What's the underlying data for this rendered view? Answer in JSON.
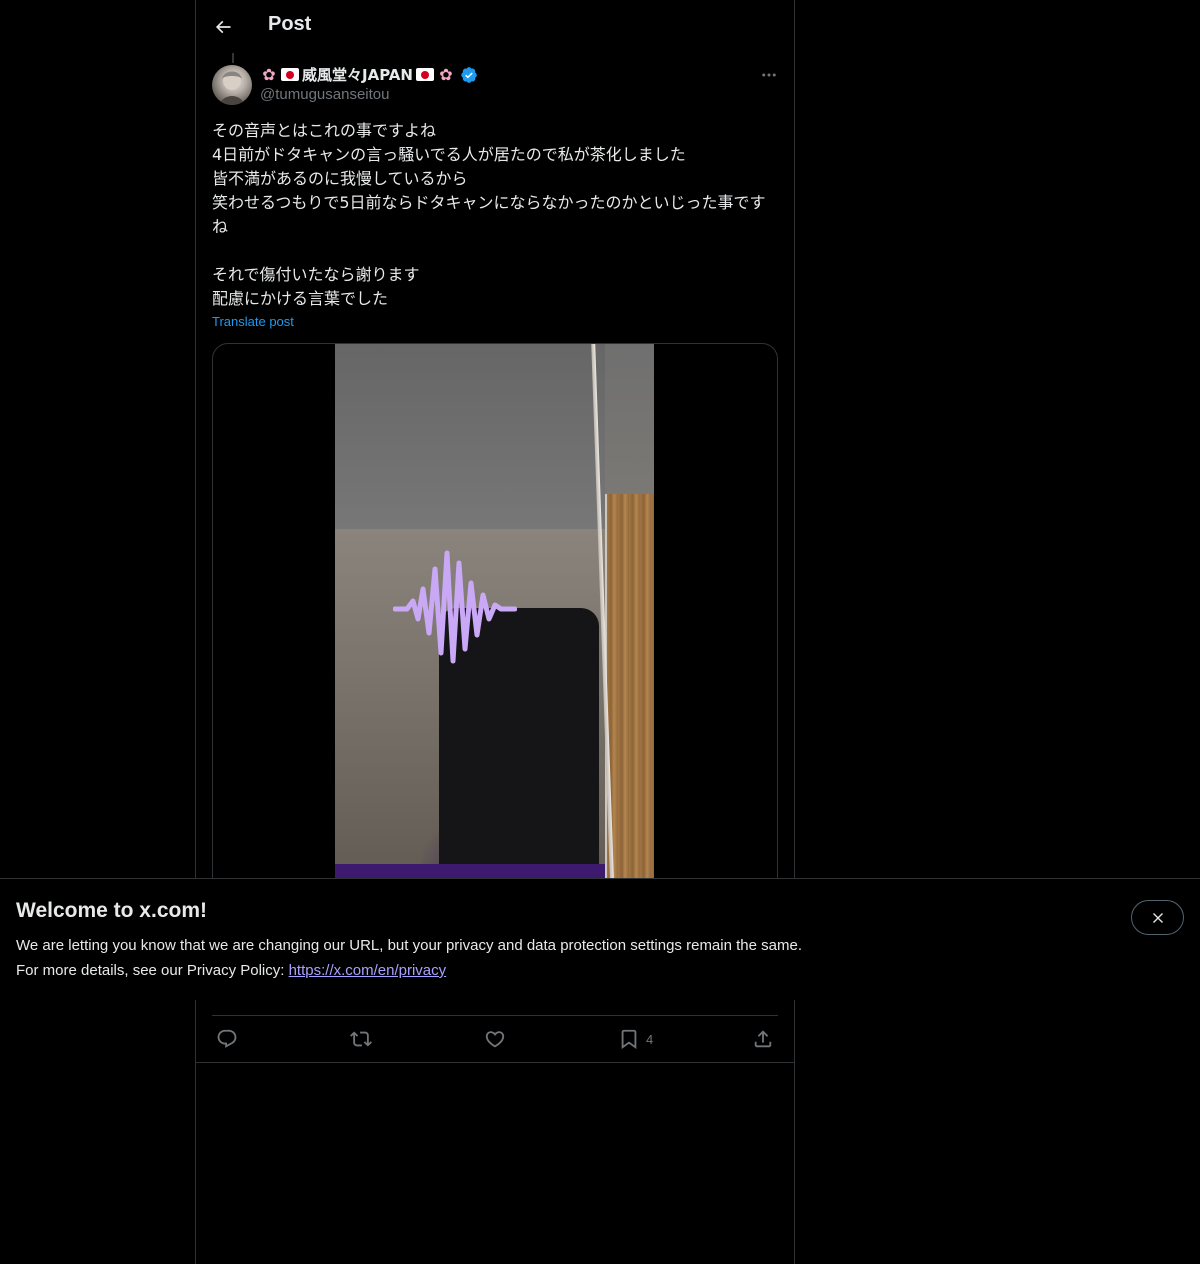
{
  "header": {
    "back_label": "Back",
    "title": "Post"
  },
  "post": {
    "author": {
      "name_prefix_icons": [
        "cherry-blossom",
        "japan-flag"
      ],
      "name": "威風堂々JAPAN",
      "name_suffix_icons": [
        "japan-flag",
        "cherry-blossom"
      ],
      "verified": true,
      "handle": "@tumugusanseitou"
    },
    "text": "その音声とはこれの事ですよね\n4日前がドタキャンの言っ騒いでる人が居たので私が茶化しました\n皆不満があるのに我慢しているから\n笑わせるつもりで5日前ならドタキャンにならなかったのかといじった事ですね\n\nそれで傷付いたなら謝ります\n配慮にかける言葉でした",
    "translate_label": "Translate post",
    "media": {
      "type": "video",
      "overlay_icon": "audio-waveform-icon"
    },
    "actions": {
      "reply": {
        "icon": "reply-icon",
        "count": ""
      },
      "repost": {
        "icon": "repost-icon",
        "count": ""
      },
      "like": {
        "icon": "heart-icon",
        "count": ""
      },
      "bookmark": {
        "icon": "bookmark-icon",
        "count": "4"
      },
      "share": {
        "icon": "share-icon",
        "count": ""
      }
    }
  },
  "banner": {
    "title": "Welcome to x.com!",
    "line1": "We are letting you know that we are changing our URL, but your privacy and data protection settings remain the same.",
    "line2_prefix": "For more details, see our Privacy Policy: ",
    "link_text": "https://x.com/en/privacy"
  },
  "colors": {
    "background": "#000000",
    "text_primary": "#e7e9ea",
    "text_secondary": "#71767b",
    "accent": "#1d9bf0",
    "border": "#2f3336",
    "link_visited": "#a9a0ff",
    "waveform": "#c9a8f5"
  }
}
